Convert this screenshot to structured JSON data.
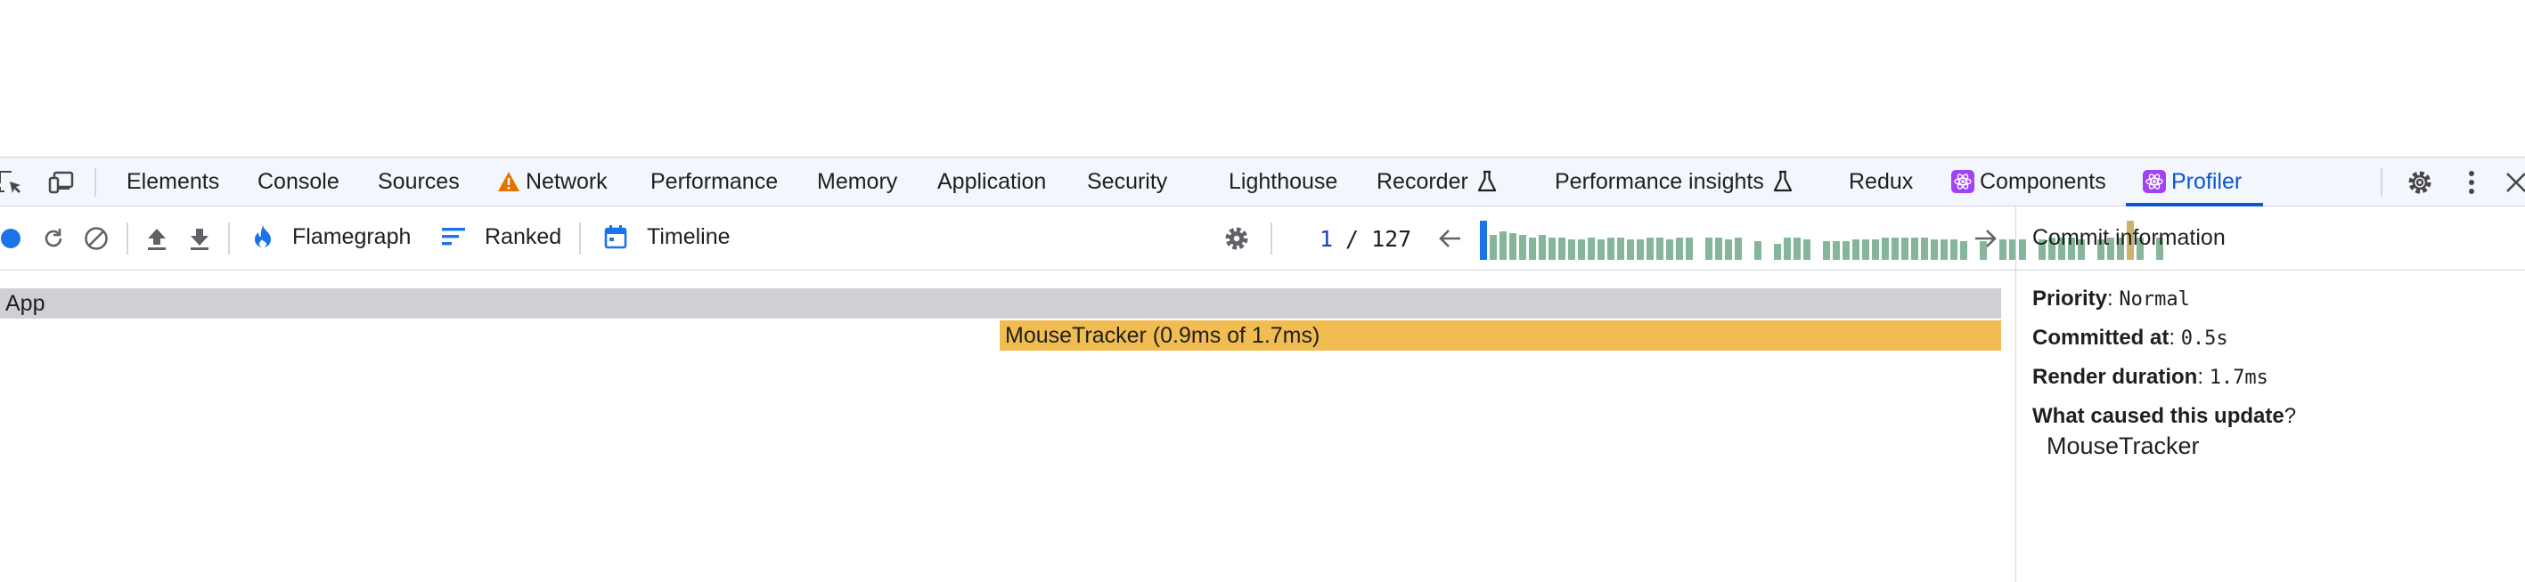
{
  "tabbar": {
    "tabs": [
      {
        "label": "Elements"
      },
      {
        "label": "Console"
      },
      {
        "label": "Sources"
      },
      {
        "label": "Network",
        "icon": "warning-icon"
      },
      {
        "label": "Performance"
      },
      {
        "label": "Memory"
      },
      {
        "label": "Application"
      },
      {
        "label": "Security"
      },
      {
        "label": "Lighthouse"
      },
      {
        "label": "Recorder",
        "icon": "flask-icon"
      },
      {
        "label": "Performance insights",
        "icon": "flask-icon"
      },
      {
        "label": "Redux"
      },
      {
        "label": "Components",
        "icon": "react-icon"
      },
      {
        "label": "Profiler",
        "icon": "react-icon",
        "active": true
      }
    ]
  },
  "toolbar": {
    "modes": [
      {
        "label": "Flamegraph",
        "icon": "flame-icon",
        "active": true
      },
      {
        "label": "Ranked",
        "icon": "ranked-icon"
      },
      {
        "label": "Timeline",
        "icon": "calendar-icon"
      }
    ],
    "commit_current": "1",
    "commit_total": "127",
    "commit_separator": "/"
  },
  "commit_bars": [
    0.95,
    0.6,
    0.7,
    0.65,
    0.6,
    0.55,
    0.6,
    0.55,
    0.55,
    0.5,
    0.5,
    0.55,
    0.5,
    0.55,
    0.55,
    0.5,
    0.5,
    0.55,
    0.55,
    0.5,
    0.55,
    0.55,
    0.0,
    0.55,
    0.55,
    0.5,
    0.55,
    0.0,
    0.45,
    0.0,
    0.4,
    0.55,
    0.55,
    0.5,
    0.0,
    0.45,
    0.45,
    0.45,
    0.5,
    0.5,
    0.5,
    0.55,
    0.55,
    0.55,
    0.55,
    0.55,
    0.5,
    0.5,
    0.5,
    0.45,
    0.0,
    0.45,
    0.0,
    0.5,
    0.5,
    0.5,
    0.0,
    0.5,
    0.55,
    0.55,
    0.55,
    0.5,
    0.0,
    0.5,
    0.55,
    0.55,
    0.95,
    0.55,
    0.0,
    0.55
  ],
  "flamegraph": {
    "nodes": [
      {
        "label": "App"
      },
      {
        "label": "MouseTracker (0.9ms of 1.7ms)"
      }
    ]
  },
  "sidebar": {
    "title": "Commit information",
    "priority_label": "Priority",
    "priority_value": "Normal",
    "committed_label": "Committed at",
    "committed_value": "0.5s",
    "duration_label": "Render duration",
    "duration_value": "1.7ms",
    "cause_label": "What caused this update",
    "cause_items": [
      "MouseTracker"
    ]
  },
  "colors": {
    "accent": "#1a73e8",
    "commit_bar": "#85b69a",
    "flame_app": "#cfd0d3",
    "flame_component": "#f1bc51"
  }
}
